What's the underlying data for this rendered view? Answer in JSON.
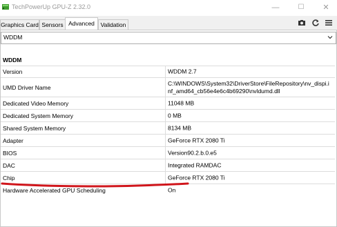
{
  "window": {
    "title": "TechPowerUp GPU-Z 2.32.0",
    "minimize": "—",
    "maximize": "☐",
    "close": "✕"
  },
  "tabs": [
    {
      "label": "Graphics Card"
    },
    {
      "label": "Sensors"
    },
    {
      "label": "Advanced"
    },
    {
      "label": "Validation"
    }
  ],
  "toolbar": {
    "icons": [
      "camera-icon",
      "refresh-icon",
      "menu-icon"
    ]
  },
  "dropdown": {
    "selected": "WDDM"
  },
  "section": {
    "title": "WDDM"
  },
  "rows": [
    {
      "label": "Version",
      "value": "WDDM 2.7"
    },
    {
      "label": "UMD Driver Name",
      "value": "C:\\WINDOWS\\System32\\DriverStore\\FileRepository\\nv_dispi.inf_amd64_cb56e4e6c4b69290\\nvldumd.dll"
    },
    {
      "label": "Dedicated Video Memory",
      "value": "11048 MB"
    },
    {
      "label": "Dedicated System Memory",
      "value": "0 MB"
    },
    {
      "label": "Shared System Memory",
      "value": "8134 MB"
    },
    {
      "label": "Adapter",
      "value": "GeForce RTX 2080 Ti"
    },
    {
      "label": "BIOS",
      "value": "Version90.2.b.0.e5"
    },
    {
      "label": "DAC",
      "value": "Integrated RAMDAC"
    },
    {
      "label": "Chip",
      "value": "GeForce RTX 2080 Ti"
    },
    {
      "label": "Hardware Accelerated GPU Scheduling",
      "value": "On"
    }
  ],
  "colors": {
    "underline_annotation": "#d0151b",
    "app_icon": "#3e9b2e"
  }
}
